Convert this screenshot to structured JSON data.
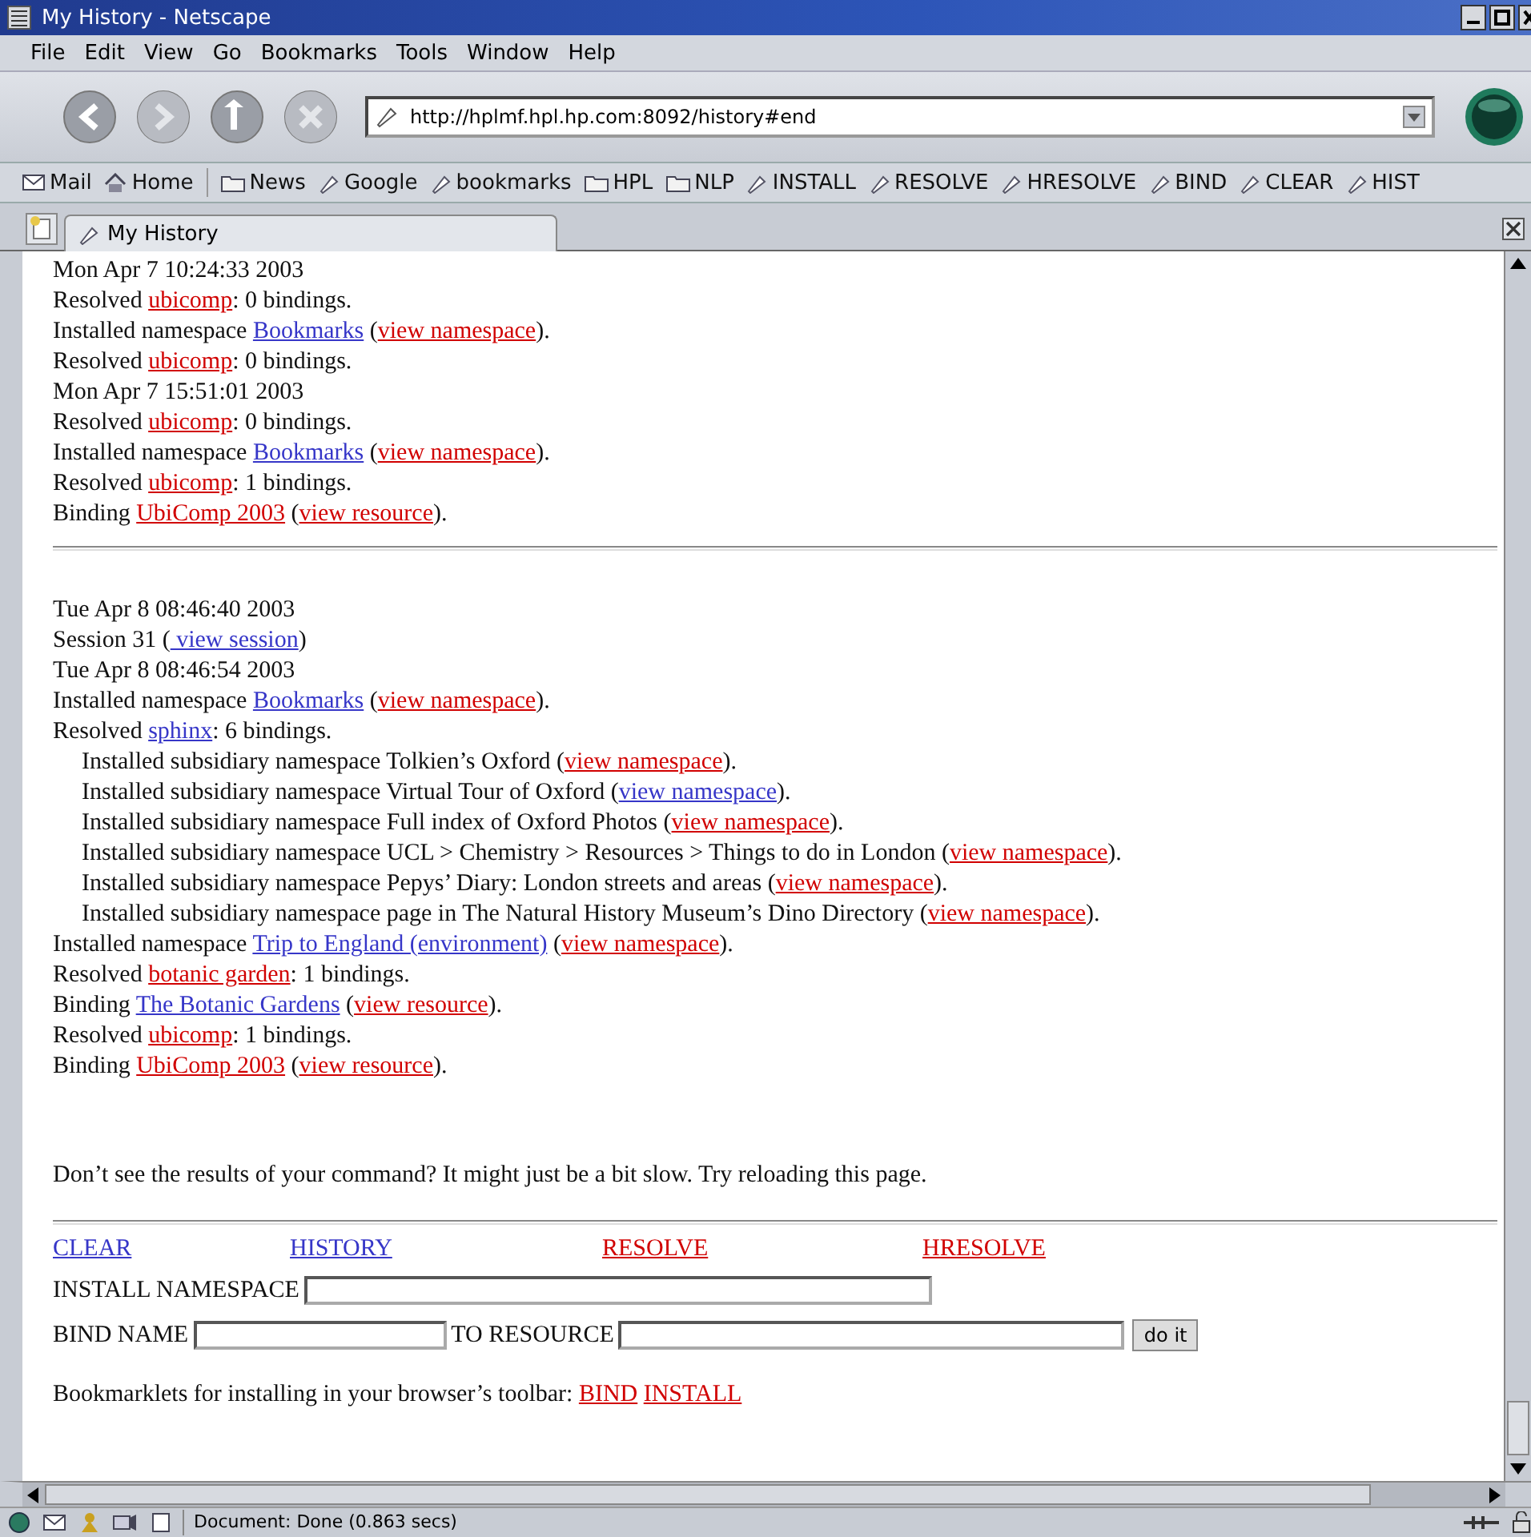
{
  "window": {
    "title": "My History - Netscape"
  },
  "menu": [
    "File",
    "Edit",
    "View",
    "Go",
    "Bookmarks",
    "Tools",
    "Window",
    "Help"
  ],
  "address": {
    "value": "http://hplmf.hpl.hp.com:8092/history#end"
  },
  "bookmarks": [
    {
      "kind": "mail",
      "label": "Mail"
    },
    {
      "kind": "home",
      "label": "Home"
    },
    {
      "kind": "folder",
      "label": "News"
    },
    {
      "kind": "bookmark",
      "label": "Google"
    },
    {
      "kind": "bookmark",
      "label": "bookmarks"
    },
    {
      "kind": "folder",
      "label": "HPL"
    },
    {
      "kind": "folder",
      "label": "NLP"
    },
    {
      "kind": "bookmark",
      "label": "INSTALL"
    },
    {
      "kind": "bookmark",
      "label": "RESOLVE"
    },
    {
      "kind": "bookmark",
      "label": "HRESOLVE"
    },
    {
      "kind": "bookmark",
      "label": "BIND"
    },
    {
      "kind": "bookmark",
      "label": "CLEAR"
    },
    {
      "kind": "bookmark",
      "label": "HIST"
    }
  ],
  "tabs": [
    {
      "label": "My History",
      "selected": true
    }
  ],
  "sections": [
    {
      "lines": [
        {
          "segments": [
            {
              "kind": "text",
              "text": "Mon Apr 7 10:24:33 2003"
            }
          ]
        },
        {
          "segments": [
            {
              "kind": "text",
              "text": "Resolved "
            },
            {
              "kind": "link",
              "text": "ubicomp",
              "visited": true
            },
            {
              "kind": "text",
              "text": ": 0 bindings."
            }
          ]
        },
        {
          "segments": [
            {
              "kind": "text",
              "text": "Installed namespace "
            },
            {
              "kind": "link",
              "text": "Bookmarks",
              "visited": false
            },
            {
              "kind": "text",
              "text": " ("
            },
            {
              "kind": "link",
              "text": "view namespace",
              "visited": true
            },
            {
              "kind": "text",
              "text": ")."
            }
          ]
        },
        {
          "segments": [
            {
              "kind": "text",
              "text": "Resolved "
            },
            {
              "kind": "link",
              "text": "ubicomp",
              "visited": true
            },
            {
              "kind": "text",
              "text": ": 0 bindings."
            }
          ]
        },
        {
          "segments": [
            {
              "kind": "text",
              "text": "Mon Apr 7 15:51:01 2003"
            }
          ]
        },
        {
          "segments": [
            {
              "kind": "text",
              "text": "Resolved "
            },
            {
              "kind": "link",
              "text": "ubicomp",
              "visited": true
            },
            {
              "kind": "text",
              "text": ": 0 bindings."
            }
          ]
        },
        {
          "segments": [
            {
              "kind": "text",
              "text": "Installed namespace "
            },
            {
              "kind": "link",
              "text": "Bookmarks",
              "visited": false
            },
            {
              "kind": "text",
              "text": " ("
            },
            {
              "kind": "link",
              "text": "view namespace",
              "visited": true
            },
            {
              "kind": "text",
              "text": ")."
            }
          ]
        },
        {
          "segments": [
            {
              "kind": "text",
              "text": "Resolved "
            },
            {
              "kind": "link",
              "text": "ubicomp",
              "visited": true
            },
            {
              "kind": "text",
              "text": ": 1 bindings."
            }
          ]
        },
        {
          "segments": [
            {
              "kind": "text",
              "text": "Binding "
            },
            {
              "kind": "link",
              "text": "UbiComp 2003",
              "visited": true
            },
            {
              "kind": "text",
              "text": " ("
            },
            {
              "kind": "link",
              "text": "view resource",
              "visited": true
            },
            {
              "kind": "text",
              "text": ")."
            }
          ]
        }
      ]
    },
    {
      "lines": [
        {
          "segments": [
            {
              "kind": "text",
              "text": "Tue Apr 8 08:46:40 2003"
            }
          ]
        },
        {
          "segments": [
            {
              "kind": "text",
              "text": "Session 31 ("
            },
            {
              "kind": "link",
              "text": " view session",
              "visited": false
            },
            {
              "kind": "text",
              "text": ")"
            }
          ]
        },
        {
          "segments": [
            {
              "kind": "text",
              "text": "Tue Apr 8 08:46:54 2003"
            }
          ]
        },
        {
          "segments": [
            {
              "kind": "text",
              "text": "Installed namespace "
            },
            {
              "kind": "link",
              "text": "Bookmarks",
              "visited": false
            },
            {
              "kind": "text",
              "text": " ("
            },
            {
              "kind": "link",
              "text": "view namespace",
              "visited": true
            },
            {
              "kind": "text",
              "text": ")."
            }
          ]
        },
        {
          "segments": [
            {
              "kind": "text",
              "text": "Resolved "
            },
            {
              "kind": "link",
              "text": "sphinx",
              "visited": false
            },
            {
              "kind": "text",
              "text": ": 6 bindings."
            }
          ],
          "children": [
            {
              "segments": [
                {
                  "kind": "text",
                  "text": "Installed subsidiary namespace Tolkien’s Oxford ("
                },
                {
                  "kind": "link",
                  "text": "view namespace",
                  "visited": true
                },
                {
                  "kind": "text",
                  "text": ")."
                }
              ]
            },
            {
              "segments": [
                {
                  "kind": "text",
                  "text": "Installed subsidiary namespace Virtual Tour of Oxford ("
                },
                {
                  "kind": "link",
                  "text": "view namespace",
                  "visited": false
                },
                {
                  "kind": "text",
                  "text": ")."
                }
              ]
            },
            {
              "segments": [
                {
                  "kind": "text",
                  "text": "Installed subsidiary namespace Full index of Oxford Photos ("
                },
                {
                  "kind": "link",
                  "text": "view namespace",
                  "visited": true
                },
                {
                  "kind": "text",
                  "text": ")."
                }
              ]
            },
            {
              "segments": [
                {
                  "kind": "text",
                  "text": "Installed subsidiary namespace UCL > Chemistry > Resources > Things to do in London ("
                },
                {
                  "kind": "link",
                  "text": "view namespace",
                  "visited": true
                },
                {
                  "kind": "text",
                  "text": ")."
                }
              ]
            },
            {
              "segments": [
                {
                  "kind": "text",
                  "text": "Installed subsidiary namespace Pepys’ Diary: London streets and areas ("
                },
                {
                  "kind": "link",
                  "text": "view namespace",
                  "visited": true
                },
                {
                  "kind": "text",
                  "text": ")."
                }
              ]
            },
            {
              "segments": [
                {
                  "kind": "text",
                  "text": "Installed subsidiary namespace page in The Natural History Museum’s Dino Directory ("
                },
                {
                  "kind": "link",
                  "text": "view namespace",
                  "visited": true
                },
                {
                  "kind": "text",
                  "text": ")."
                }
              ]
            }
          ]
        },
        {
          "segments": [
            {
              "kind": "text",
              "text": "Installed namespace "
            },
            {
              "kind": "link",
              "text": "Trip to England (environment)",
              "visited": false
            },
            {
              "kind": "text",
              "text": " ("
            },
            {
              "kind": "link",
              "text": "view namespace",
              "visited": true
            },
            {
              "kind": "text",
              "text": ")."
            }
          ]
        },
        {
          "segments": [
            {
              "kind": "text",
              "text": "Resolved "
            },
            {
              "kind": "link",
              "text": "botanic garden",
              "visited": true
            },
            {
              "kind": "text",
              "text": ": 1 bindings."
            }
          ]
        },
        {
          "segments": [
            {
              "kind": "text",
              "text": "Binding "
            },
            {
              "kind": "link",
              "text": "The Botanic Gardens",
              "visited": false
            },
            {
              "kind": "text",
              "text": " ("
            },
            {
              "kind": "link",
              "text": "view resource",
              "visited": true
            },
            {
              "kind": "text",
              "text": ")."
            }
          ]
        },
        {
          "segments": [
            {
              "kind": "text",
              "text": "Resolved "
            },
            {
              "kind": "link",
              "text": "ubicomp",
              "visited": true
            },
            {
              "kind": "text",
              "text": ": 1 bindings."
            }
          ]
        },
        {
          "segments": [
            {
              "kind": "text",
              "text": "Binding "
            },
            {
              "kind": "link",
              "text": "UbiComp 2003",
              "visited": true
            },
            {
              "kind": "text",
              "text": " ("
            },
            {
              "kind": "link",
              "text": "view resource",
              "visited": true
            },
            {
              "kind": "text",
              "text": ")."
            }
          ]
        }
      ]
    }
  ],
  "note": "Don’t see the results of your command? It might just be a bit slow. Try reloading this page.",
  "commands": [
    {
      "label": "CLEAR",
      "visited": false
    },
    {
      "label": "HISTORY",
      "visited": false
    },
    {
      "label": "RESOLVE",
      "visited": true
    },
    {
      "label": "HRESOLVE",
      "visited": true
    }
  ],
  "install_form": {
    "label": "INSTALL NAMESPACE"
  },
  "bind_form": {
    "name_label": "BIND NAME",
    "resource_label": "TO RESOURCE",
    "button": "do it"
  },
  "bookmarklets": {
    "text": "Bookmarklets for installing in your browser’s toolbar: ",
    "links": [
      {
        "label": "BIND",
        "visited": true
      },
      {
        "label": "INSTALL",
        "visited": true
      }
    ]
  },
  "status_bar": {
    "text": "Document: Done (0.863 secs)"
  }
}
